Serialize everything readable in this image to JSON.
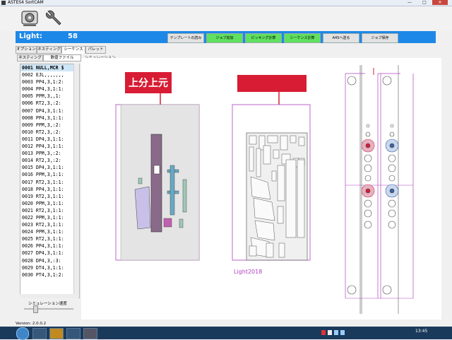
{
  "window": {
    "title": "ASTES4 SortCAM",
    "minimize": "—",
    "maximize": "□",
    "close": "✕"
  },
  "header": {
    "label": "Light:",
    "number": "58",
    "buttons": [
      {
        "label": "テンプレートの読み",
        "style": "gray"
      },
      {
        "label": "ジョブ追加",
        "style": "green"
      },
      {
        "label": "ピッキング計算",
        "style": "green"
      },
      {
        "label": "シーケンス計算",
        "style": "green"
      },
      {
        "label": "A4Sへ送る",
        "style": "gray"
      },
      {
        "label": "ジョブ保存",
        "style": "gray"
      }
    ]
  },
  "tabs": [
    "オプション",
    "ネスティング",
    "シーケンス",
    "パレット"
  ],
  "active_tab": 2,
  "subtabs": [
    "ネスティング",
    "数値ファイル"
  ],
  "active_subtab": 1,
  "simulation_label": "シミュレーション",
  "sequence_list": [
    "0001 NULL,MCR $",
    "0002 EJL,,,,,,,",
    "0003 PP4,3,1:2:",
    "0004 PP4,3,1:1:",
    "0005 PPM,3,,1:",
    "0006 RT2,3,:2:",
    "0007 DP4,3,1:1:",
    "0008 PP4,3,1:1:",
    "0009 PPM,3,:2:",
    "0010 RT2,3,:2:",
    "0011 DP4,3,1:1:",
    "0012 PP4,3,1:1:",
    "0013 PPM,3,:2:",
    "0014 RT2,3,:2:",
    "0015 DP4,3,1:1:",
    "0016 PPM,3,1:1:",
    "0017 RT2,3,1:1:",
    "0018 PP4,3,1:1:",
    "0019 RT2,3,1:1:",
    "0020 PPM,3,1:1:",
    "0021 RT2,3,1:1:",
    "0022 PPM,3,1:1:",
    "0023 RT2,3,1:1:",
    "0024 PPM,3,1:1:",
    "0025 RT2,3,1:1:",
    "0026 PP4,3,1:1:",
    "0027 DP4,3,1:1:",
    "0028 DP4,3,:3:",
    "0029 DT4,3,1:1:",
    "0030 PT4,3,1:2:"
  ],
  "selected_row": 0,
  "speed_label": "シミュレーション速度",
  "speed_value": 0.2,
  "sheet_title_left": "上分上元",
  "sheet_caption": "Light2018",
  "status": "Version: 2.0.0.2",
  "clock": "13:45",
  "colors": {
    "accent": "#1e88e8",
    "green": "#5fe05f",
    "banner": "#d81c34",
    "sheet_outline": "#b040c0"
  },
  "icons": [
    "app-icon",
    "disc-drive-icon",
    "wrench-icon",
    "start-icon",
    "ie-icon",
    "folder-icon",
    "media-icon",
    "app-task-icon"
  ]
}
